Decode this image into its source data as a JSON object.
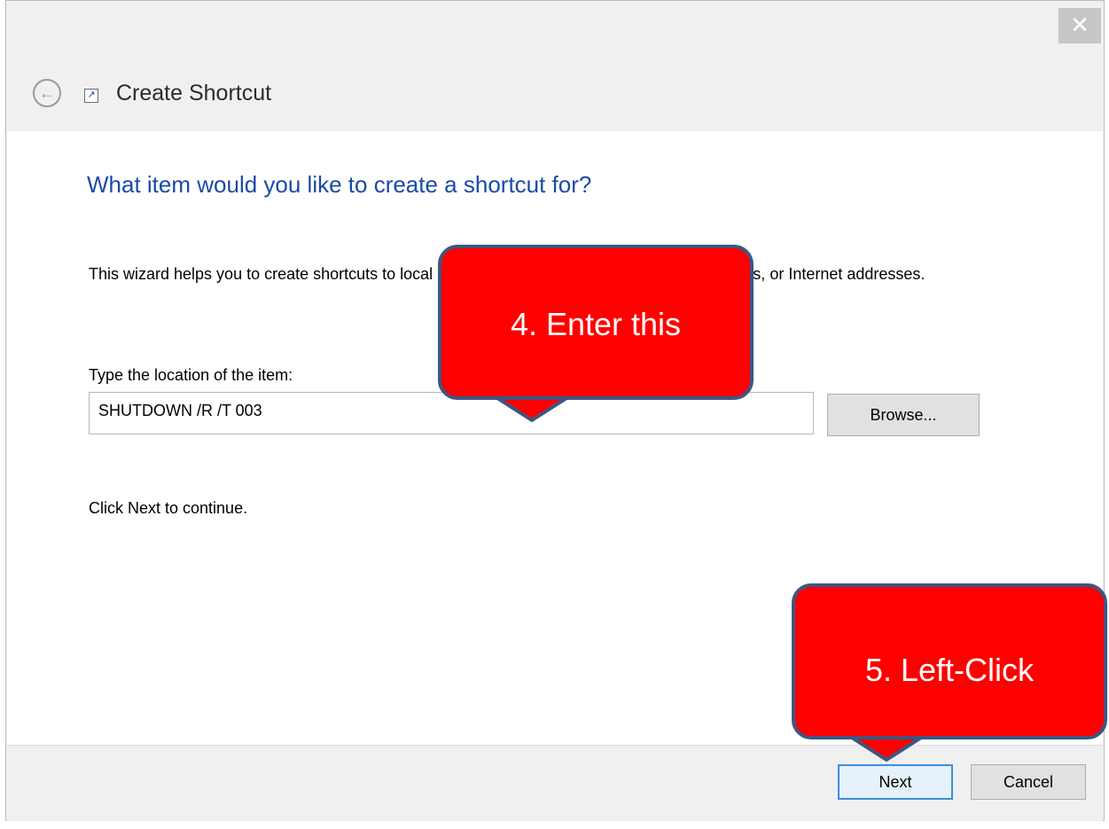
{
  "window": {
    "close_glyph": "✕",
    "title": "Create Shortcut",
    "back_glyph": "←",
    "shortcut_glyph": "↗"
  },
  "content": {
    "question": "What item would you like to create a shortcut for?",
    "intro": "This wizard helps you to create shortcuts to local or network programs, files, folders, computers, or Internet addresses.",
    "location_label": "Type the location of the item:",
    "location_value": "SHUTDOWN /R /T 003",
    "browse_label": "Browse...",
    "hint": "Click Next to continue."
  },
  "footer": {
    "next_label": "Next",
    "cancel_label": "Cancel"
  },
  "annotations": {
    "step4": "4.  Enter this",
    "step5": "5.  Left-Click"
  },
  "colors": {
    "callout_fill": "#ff0000",
    "callout_border": "#3d5682",
    "title_blue": "#1b4aa8",
    "focus_blue": "#3c8fe0"
  }
}
